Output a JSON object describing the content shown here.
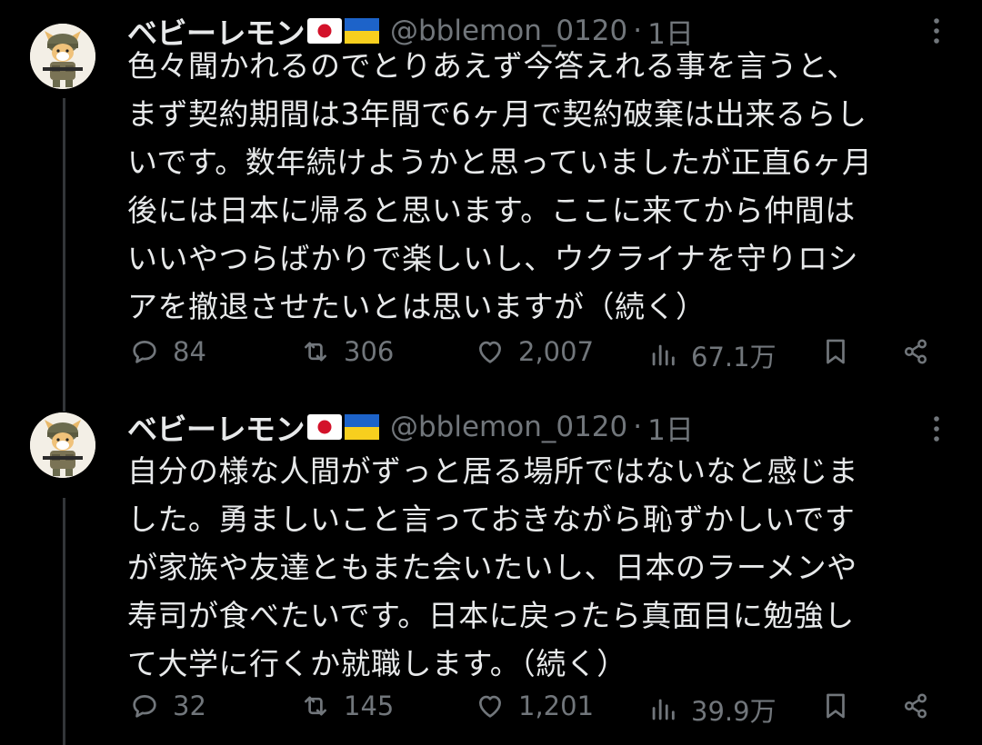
{
  "tweets": [
    {
      "name": "ベビーレモン",
      "flags": [
        "japan-flag",
        "ukraine-flag"
      ],
      "handle": "@bblemon_0120",
      "dot": "·",
      "time": "1日",
      "lines": [
        "色々聞かれるのでとりあえず今答えれる事を言うと、",
        "まず契約期間は3年間で6ヶ月で契約破棄は出来るらし",
        "いです。数年続けようかと思っていましたが正直6ヶ月",
        "後には日本に帰ると思います。ここに来てから仲間は",
        "いいやつらばかりで楽しいし、ウクライナを守りロシ",
        "アを撤退させたいとは思いますが（続く）"
      ],
      "replies": "84",
      "retweets": "306",
      "likes": "2,007",
      "views": "67.1万"
    },
    {
      "name": "ベビーレモン",
      "flags": [
        "japan-flag",
        "ukraine-flag"
      ],
      "handle": "@bblemon_0120",
      "dot": "·",
      "time": "1日",
      "lines": [
        "自分の様な人間がずっと居る場所ではないなと感じま",
        "した。勇ましいこと言っておきながら恥ずかしいです",
        "が家族や友達ともまた会いたいし、日本のラーメンや",
        "寿司が食べたいです。日本に戻ったら真面目に勉強し",
        "て大学に行くか就職します。（続く）"
      ],
      "replies": "32",
      "retweets": "145",
      "likes": "1,201",
      "views": "39.9万"
    }
  ],
  "colors": {
    "background": "#000000",
    "text": "#e7e9ea",
    "muted": "#71767b",
    "thread": "#333639"
  }
}
